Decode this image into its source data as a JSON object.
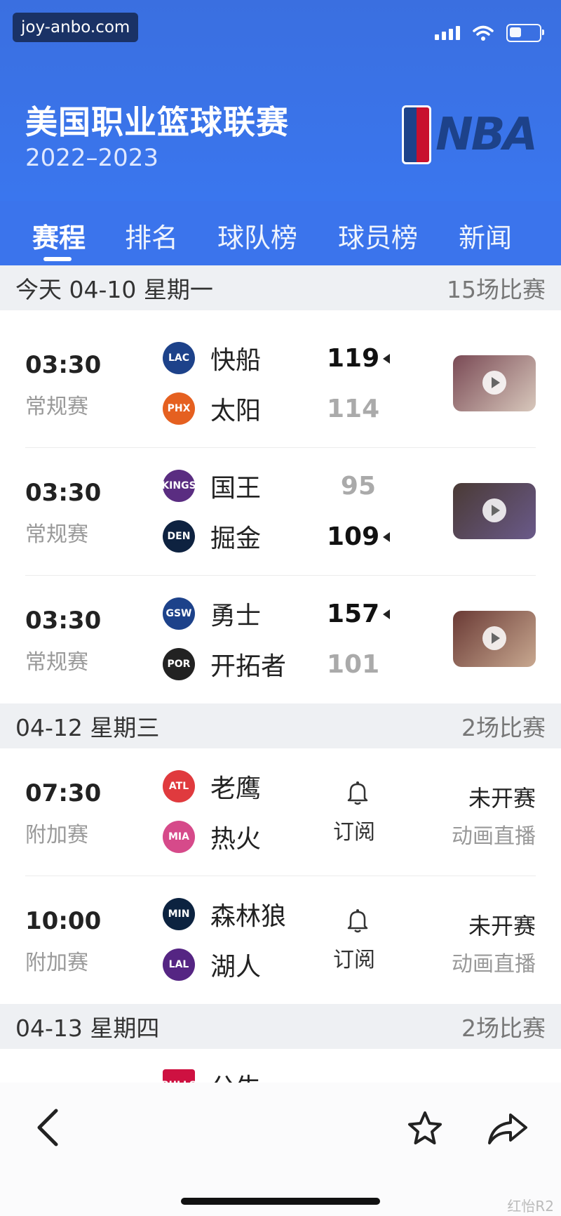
{
  "watermark_url": "joy-anbo.com",
  "header": {
    "title": "美国职业篮球联赛",
    "season": "2022–2023",
    "logo_text": "NBA"
  },
  "tabs": [
    "赛程",
    "排名",
    "球队榜",
    "球员榜",
    "新闻"
  ],
  "days": [
    {
      "date": "今天 04-10 星期一",
      "count": "15场比赛",
      "games": [
        {
          "time": "03:30",
          "type": "常规赛",
          "home": {
            "name": "快船",
            "logo": "LAC",
            "color": "#1d428a",
            "score": "119"
          },
          "away": {
            "name": "太阳",
            "logo": "PHX",
            "color": "#e56020",
            "score": "114"
          },
          "winner": "home",
          "thumb_colors": [
            "#7a4a55",
            "#d8c8bc"
          ]
        },
        {
          "time": "03:30",
          "type": "常规赛",
          "home": {
            "name": "国王",
            "logo": "KINGS",
            "color": "#5a2d81",
            "score": "95"
          },
          "away": {
            "name": "掘金",
            "logo": "DEN",
            "color": "#0e2240",
            "score": "109"
          },
          "winner": "away",
          "thumb_colors": [
            "#4a3a35",
            "#6a5a8a"
          ]
        },
        {
          "time": "03:30",
          "type": "常规赛",
          "home": {
            "name": "勇士",
            "logo": "GSW",
            "color": "#1d428a",
            "score": "157"
          },
          "away": {
            "name": "开拓者",
            "logo": "POR",
            "color": "#222222",
            "score": "101"
          },
          "winner": "home",
          "thumb_colors": [
            "#6a3a35",
            "#c8a890"
          ]
        }
      ]
    },
    {
      "date": "04-12 星期三",
      "count": "2场比赛",
      "games": [
        {
          "time": "07:30",
          "type": "附加赛",
          "home": {
            "name": "老鹰",
            "logo": "ATL",
            "color": "#e03a3e"
          },
          "away": {
            "name": "热火",
            "logo": "MIA",
            "color": "#d64a8a"
          },
          "subscribe": "订阅",
          "status": "未开赛",
          "status2": "动画直播"
        },
        {
          "time": "10:00",
          "type": "附加赛",
          "home": {
            "name": "森林狼",
            "logo": "MIN",
            "color": "#0c2340"
          },
          "away": {
            "name": "湖人",
            "logo": "LAL",
            "color": "#552583"
          },
          "subscribe": "订阅",
          "status": "未开赛",
          "status2": "动画直播"
        }
      ]
    },
    {
      "date": "04-13 星期四",
      "count": "2场比赛"
    }
  ],
  "peek": {
    "logo": "BULLS",
    "name": "公牛"
  },
  "footer_watermark": "红怡R2",
  "icons": [
    "back-icon",
    "star-icon",
    "share-icon",
    "bell-icon",
    "play-icon",
    "wifi-icon",
    "battery-icon"
  ]
}
